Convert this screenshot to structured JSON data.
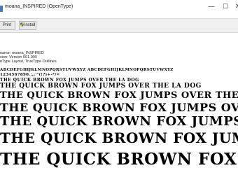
{
  "window": {
    "title": "moana_INSPIRED (OpenType)",
    "minimize_glyph": "—",
    "maximize_glyph": "☐",
    "close_glyph": "✕"
  },
  "toolbar": {
    "print_label": "Print",
    "install_label": "Install"
  },
  "font_info": {
    "name_line": "name: moana_INSPIRED",
    "version_line": "sion: Version 001.000",
    "type_line": "nType Layout, TrueType Outlines"
  },
  "sample": {
    "charset_upper": "ABCDEFGHIJKLMNOPQRSTUVWXYZ ABCDEFGHIJKLMNOPQRSTUVWXYZ",
    "charset_digits": "1234567890.:,;'\"(!?)+-*/=",
    "line_1": "THE QUICK BROWN FOX JUMPS OVER THE LA DOG",
    "line_2": "THE QUICK BROWN FOX JUMPS OVER THE LA DOG",
    "line_3": "THE QUICK BROWN FOX JUMPS OVER THE LA DO",
    "line_4": "THE QUICK BROWN FOX JUMPS OVER THE LA",
    "line_5": "THE QUICK BROWN FOX JUMPS OVER T",
    "line_6": "THE QUICK BROWN FOX JUMPS OVE",
    "line_7": "THE QUICK BROWN FOX JUM"
  },
  "colors": {
    "accent": "#4a79b8",
    "shield_blue": "#2f6fc1",
    "shield_yellow": "#f2c200"
  }
}
